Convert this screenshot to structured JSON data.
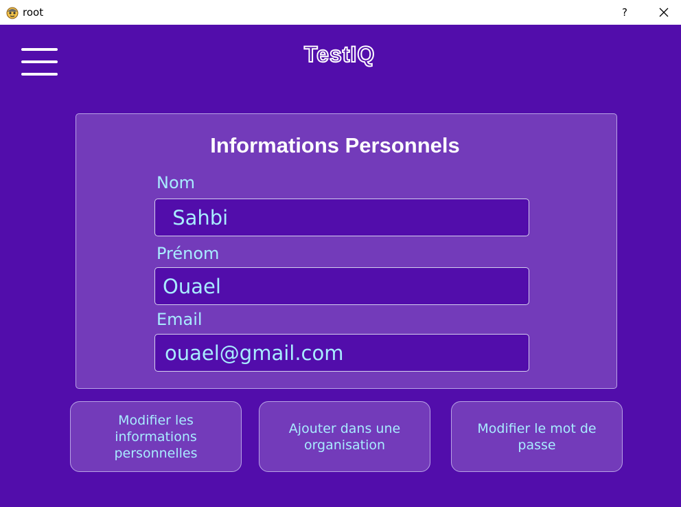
{
  "window": {
    "title": "root",
    "help_label": "?"
  },
  "logo": {
    "text": "TestIQ"
  },
  "card": {
    "title": "Informations Personnels",
    "fields": [
      {
        "label": "Nom",
        "value": " Sahbi"
      },
      {
        "label": "Prénom",
        "value": "Ouael"
      },
      {
        "label": "Email",
        "value": "ouael@gmail.com"
      }
    ]
  },
  "actions": [
    {
      "label": "Modifier les informations personnelles"
    },
    {
      "label": "Ajouter dans une organisation"
    },
    {
      "label": "Modifier le mot de passe"
    }
  ],
  "colors": {
    "background": "#520dab",
    "card": "#733bba",
    "text_accent": "#a8ecff"
  }
}
